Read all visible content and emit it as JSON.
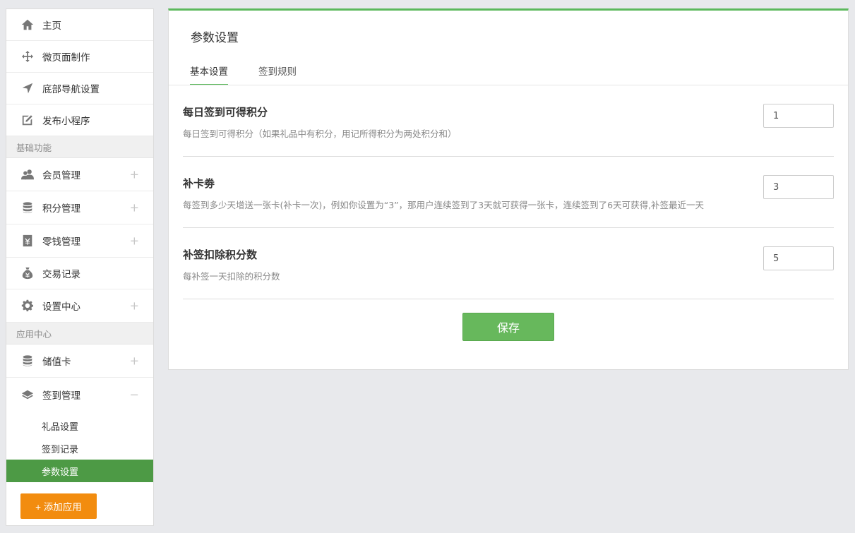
{
  "sidebar": {
    "items_top": [
      {
        "label": "主页",
        "icon": "home-icon"
      },
      {
        "label": "微页面制作",
        "icon": "move-icon"
      },
      {
        "label": "底部导航设置",
        "icon": "navigation-arrow-icon"
      },
      {
        "label": "发布小程序",
        "icon": "edit-icon"
      }
    ],
    "section_basic": "基础功能",
    "items_basic": [
      {
        "label": "会员管理",
        "icon": "users-icon",
        "expander": "+"
      },
      {
        "label": "积分管理",
        "icon": "database-icon",
        "expander": "+"
      },
      {
        "label": "零钱管理",
        "icon": "cash-box-icon",
        "expander": "+"
      },
      {
        "label": "交易记录",
        "icon": "money-bag-icon"
      },
      {
        "label": "设置中心",
        "icon": "gear-icon",
        "expander": "+"
      }
    ],
    "section_apps": "应用中心",
    "items_apps": [
      {
        "label": "储值卡",
        "icon": "database-icon",
        "expander": "+"
      },
      {
        "label": "签到管理",
        "icon": "layers-icon",
        "expander": "−"
      }
    ],
    "sub_items": [
      "礼品设置",
      "签到记录",
      "参数设置"
    ],
    "add_app": "+ 添加应用"
  },
  "main": {
    "title": "参数设置",
    "tabs": [
      "基本设置",
      "签到规则"
    ],
    "settings": [
      {
        "title": "每日签到可得积分",
        "desc": "每日签到可得积分（如果礼品中有积分，用记所得积分为两处积分和）",
        "value": "1"
      },
      {
        "title": "补卡劵",
        "desc": "每签到多少天增送一张卡(补卡一次)，例如你设置为“3”，那用户连续签到了3天就可获得一张卡，连续签到了6天可获得,补签最近一天",
        "value": "3"
      },
      {
        "title": "补签扣除积分数",
        "desc": "每补签一天扣除的积分数",
        "value": "5"
      }
    ],
    "save": "保存"
  },
  "colors": {
    "accent_green": "#5cb85c",
    "active_nav": "#4d9a45",
    "add_button": "#f28c0f"
  }
}
